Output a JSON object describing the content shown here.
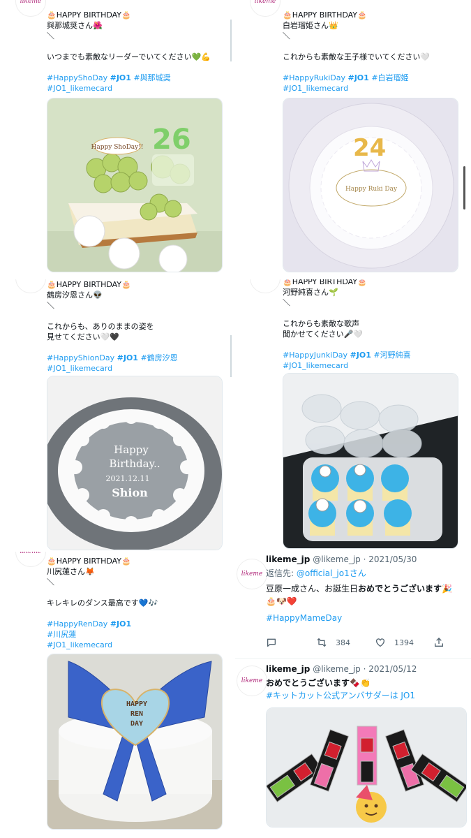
{
  "logo_text": "likeme",
  "tweets": [
    {
      "line1": "🎂HAPPY BIRTHDAY🎂",
      "line2": "與那城奨さん🌺",
      "line3": "＼",
      "line4": "いつまでも素敵なリーダーでいてください💚💪",
      "tag1": "#HappyShoDay",
      "tag2": "#JO1",
      "tag3": "#與那城奨",
      "tag4": "#JO1_likemecard",
      "photo": "green-cake"
    },
    {
      "line1": "🎂HAPPY BIRTHDAY🎂",
      "line2": "白岩瑠姫さん👑",
      "line3": "＼",
      "line4": "これからも素敵な王子様でいてください🤍",
      "tag1": "#HappyRukiDay",
      "tag2": "#JO1",
      "tag3": "#白岩瑠姫",
      "tag4": "#JO1_likemecard",
      "photo": "white-cake-24"
    },
    {
      "line1": "🎂HAPPY BIRTHDAY🎂",
      "line2": "鶴房汐恩さん👽",
      "line3": "＼",
      "line4": "これからも、ありのままの姿を",
      "line5": "見せてください🤍🖤",
      "tag1": "#HappyShionDay",
      "tag2": "#JO1",
      "tag3": "#鶴房汐恩",
      "tag4": "#JO1_likemecard",
      "photo": "grey-cake",
      "cake_text": [
        "Happy",
        "Birthday..",
        "2021.12.11",
        "Shion"
      ]
    },
    {
      "line1": "🎂HAPPY BIRTHDAY🎂",
      "line2": "河野純喜さん🌱",
      "line3": "＼",
      "line4": "これからも素敵な歌声",
      "line5": "聞かせてください🎤🤍",
      "tag1": "#HappyJunkiDay",
      "tag2": "#JO1",
      "tag3": "#河野純喜",
      "tag4": "#JO1_likemecard",
      "photo": "cupcakes"
    },
    {
      "line1": "🎂HAPPY BIRTHDAY🎂",
      "line2": "川尻蓮さん🦊",
      "line3": "＼",
      "line4": "キレキレのダンス最高です💙🎶",
      "tag1": "#HappyRenDay",
      "tag2": "#JO1",
      "tag3": "#川尻蓮",
      "tag4": "#JO1_likemecard",
      "photo": "blue-bow-cake",
      "cake_text": [
        "HAPPY",
        "REN",
        "DAY"
      ]
    }
  ],
  "green_cake_text": [
    "Happy ShoDay!!",
    "26"
  ],
  "white_cake_text": [
    "Happy Ruki Day",
    "24"
  ],
  "reply_tweet": {
    "name": "likeme_jp",
    "handle": "@likeme_jp",
    "date": "· 2021/05/30",
    "reply_prefix": "返信先: ",
    "reply_to": "@official_jo1さん",
    "body_pre": "豆原一成さん、お誕生日",
    "body_bold": "おめでとうございます",
    "body_emoji": "🎉",
    "body_line2": "🎂🐶❤️",
    "hashtag": "#HappyMameDay",
    "retweets": "384",
    "likes": "1394"
  },
  "kitkat_tweet": {
    "name": "likeme_jp",
    "handle": "@likeme_jp",
    "date": "· 2021/05/12",
    "body_bold": "おめでとうございます",
    "body_emoji": "🍫👏",
    "hashtag": "#キットカット公式アンバサダーは JO1"
  },
  "colors": {
    "link": "#1d9bf0",
    "muted": "#536471",
    "brand": "#b0287a"
  }
}
